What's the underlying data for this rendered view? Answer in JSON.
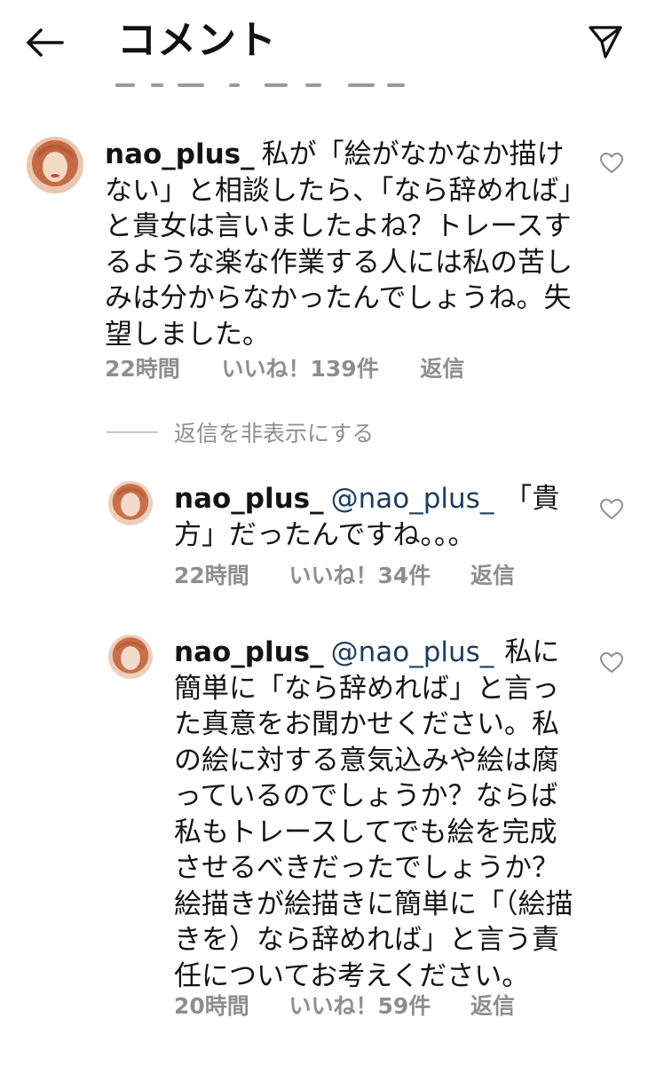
{
  "header": {
    "title": "コメント",
    "back_icon": "arrow-left-icon",
    "send_icon": "paper-plane-icon"
  },
  "comments": [
    {
      "username": "nao_plus_",
      "mention": "",
      "text": "私が「絵がなかなか描けない」と相談したら、「なら辞めれば」と貴女は言いましたよね？トレースするような楽な作業する人には私の苦しみは分からなかったんでしょうね。失望しました。",
      "time": "22時間",
      "likes": "いいね！139件",
      "reply": "返信"
    },
    {
      "username": "nao_plus_",
      "mention": "@nao_plus_",
      "text": "「貴方」だったんですね。。。",
      "time": "22時間",
      "likes": "いいね！34件",
      "reply": "返信"
    },
    {
      "username": "nao_plus_",
      "mention": "@nao_plus_",
      "text": "私に簡単に「なら辞めれば」と言った真意をお聞かせください。私の絵に対する意気込みや絵は腐っているのでしょうか？ならば私もトレースしてでも絵を完成させるべきだったでしょうか？絵描きが絵描きに簡単に「（絵描きを）なら辞めれば」と言う責任についてお考えください。",
      "time": "20時間",
      "likes": "いいね！59件",
      "reply": "返信"
    }
  ],
  "replies_toggle": "返信を非表示にする",
  "colors": {
    "mention": "#1c3d5e",
    "meta": "#8e8e8e",
    "text": "#141414"
  }
}
